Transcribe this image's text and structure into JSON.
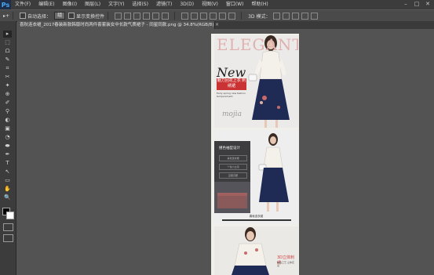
{
  "app": {
    "logo": "Ps"
  },
  "menu": [
    "文件(F)",
    "编辑(E)",
    "图像(I)",
    "图层(L)",
    "文字(Y)",
    "选择(S)",
    "滤镜(T)",
    "3D(D)",
    "视图(V)",
    "窗口(W)",
    "帮助(H)"
  ],
  "window_controls": {
    "minimize": "–",
    "maximize": "□",
    "close": "✕"
  },
  "options": {
    "move_tool": "▸+",
    "auto_select_label": "自动选择：",
    "auto_select_value": "组",
    "show_transform_label": "显示变换控件",
    "mode_3d_label": "3D 模式："
  },
  "document": {
    "tab_title": "喜秋连衣裙_2017春装新款韩版时尚两件套套装女中长款气质裙子 - 同星同款.png @ 34.8%(RGB/8) *",
    "close": "×"
  },
  "tools": [
    "▸",
    "⬚",
    "ᗝ",
    "✎",
    "⌗",
    "✂",
    "✦",
    "⊕",
    "✐",
    "⚲",
    "◐",
    "▣",
    "◔",
    "⬬",
    "✒",
    "T",
    "↖",
    "▭",
    "✋",
    "🔍"
  ],
  "colors": {
    "background": "#535353",
    "menubar": "#3c3c3c",
    "optionsbar": "#4a4a4a",
    "toolbar": "#3c3c3c",
    "accent_red": "#c93333",
    "elegant_pink": "#dfb1b1"
  },
  "canvas": {
    "panel1": {
      "title": "ELEGANT",
      "new_text": "New",
      "red_box": "魅力回花上衣\n刺绣裙",
      "small_text": "Early spring new fashion temperament",
      "brand": "mojia"
    },
    "panel2": {
      "dark_title": "撞色袖型设计",
      "lines": [
        "喜秋连衣裙",
        "个性小立领",
        "显瘦高腰"
      ],
      "caption": "喜秋连衣裙"
    },
    "panel3": {
      "red_title": "3D立体刺绣",
      "sub": "精致工艺 立体花朵"
    }
  }
}
